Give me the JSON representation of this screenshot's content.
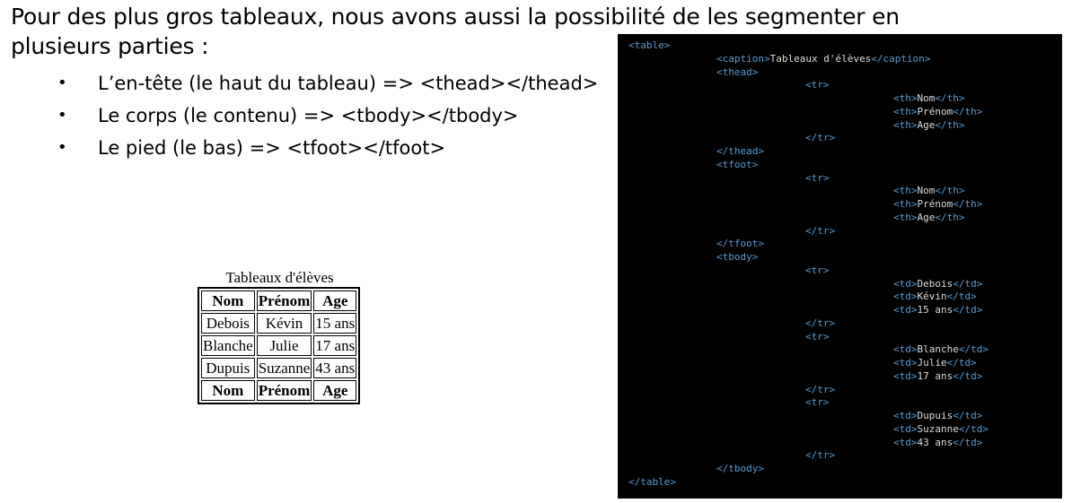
{
  "intro": "Pour des plus gros tableaux, nous avons aussi la possibilité de les segmenter en plusieurs parties :",
  "points": [
    "L’en-tête (le haut du tableau) => <thead></thead>",
    "Le corps (le contenu) => <tbody></tbody>",
    "Le pied (le bas) => <tfoot></tfoot>"
  ],
  "bullet": "•",
  "table_demo": {
    "caption": "Tableaux d'élèves",
    "head": [
      "Nom",
      "Prénom",
      "Age"
    ],
    "rows": [
      [
        "Debois",
        "Kévin",
        "15 ans"
      ],
      [
        "Blanche",
        "Julie",
        "17 ans"
      ],
      [
        "Dupuis",
        "Suzanne",
        "43 ans"
      ]
    ],
    "foot": [
      "Nom",
      "Prénom",
      "Age"
    ]
  },
  "code_lines": [
    {
      "indent": 0,
      "open": "<table>",
      "text": "",
      "close": ""
    },
    {
      "indent": 1,
      "open": "<caption>",
      "text": "Tableaux d'élèves",
      "close": "</caption>"
    },
    {
      "indent": 1,
      "open": "<thead>",
      "text": "",
      "close": ""
    },
    {
      "indent": 2,
      "open": "<tr>",
      "text": "",
      "close": ""
    },
    {
      "indent": 3,
      "open": "<th>",
      "text": "Nom",
      "close": "</th>"
    },
    {
      "indent": 3,
      "open": "<th>",
      "text": "Prénom",
      "close": "</th>"
    },
    {
      "indent": 3,
      "open": "<th>",
      "text": "Age",
      "close": "</th>"
    },
    {
      "indent": 2,
      "open": "</tr>",
      "text": "",
      "close": ""
    },
    {
      "indent": 1,
      "open": "</thead>",
      "text": "",
      "close": ""
    },
    {
      "indent": 1,
      "open": "<tfoot>",
      "text": "",
      "close": ""
    },
    {
      "indent": 2,
      "open": "<tr>",
      "text": "",
      "close": ""
    },
    {
      "indent": 3,
      "open": "<th>",
      "text": "Nom",
      "close": "</th>"
    },
    {
      "indent": 3,
      "open": "<th>",
      "text": "Prénom",
      "close": "</th>"
    },
    {
      "indent": 3,
      "open": "<th>",
      "text": "Age",
      "close": "</th>"
    },
    {
      "indent": 2,
      "open": "</tr>",
      "text": "",
      "close": ""
    },
    {
      "indent": 1,
      "open": "</tfoot>",
      "text": "",
      "close": ""
    },
    {
      "indent": 1,
      "open": "<tbody>",
      "text": "",
      "close": ""
    },
    {
      "indent": 2,
      "open": "<tr>",
      "text": "",
      "close": ""
    },
    {
      "indent": 3,
      "open": "<td>",
      "text": "Debois",
      "close": "</td>"
    },
    {
      "indent": 3,
      "open": "<td>",
      "text": "Kévin",
      "close": "</td>"
    },
    {
      "indent": 3,
      "open": "<td>",
      "text": "15 ans",
      "close": "</td>"
    },
    {
      "indent": 2,
      "open": "</tr>",
      "text": "",
      "close": ""
    },
    {
      "indent": 2,
      "open": "<tr>",
      "text": "",
      "close": ""
    },
    {
      "indent": 3,
      "open": "<td>",
      "text": "Blanche",
      "close": "</td>"
    },
    {
      "indent": 3,
      "open": "<td>",
      "text": "Julie",
      "close": "</td>"
    },
    {
      "indent": 3,
      "open": "<td>",
      "text": "17 ans",
      "close": "</td>"
    },
    {
      "indent": 2,
      "open": "</tr>",
      "text": "",
      "close": ""
    },
    {
      "indent": 2,
      "open": "<tr>",
      "text": "",
      "close": ""
    },
    {
      "indent": 3,
      "open": "<td>",
      "text": "Dupuis",
      "close": "</td>"
    },
    {
      "indent": 3,
      "open": "<td>",
      "text": "Suzanne",
      "close": "</td>"
    },
    {
      "indent": 3,
      "open": "<td>",
      "text": "43 ans",
      "close": "</td>"
    },
    {
      "indent": 2,
      "open": "</tr>",
      "text": "",
      "close": ""
    },
    {
      "indent": 1,
      "open": "</tbody>",
      "text": "",
      "close": ""
    },
    {
      "indent": 0,
      "open": "</table>",
      "text": "",
      "close": ""
    }
  ],
  "colors": {
    "code_background": "#000000",
    "code_tag": "#569cd6",
    "code_text": "#dcdcdc"
  }
}
